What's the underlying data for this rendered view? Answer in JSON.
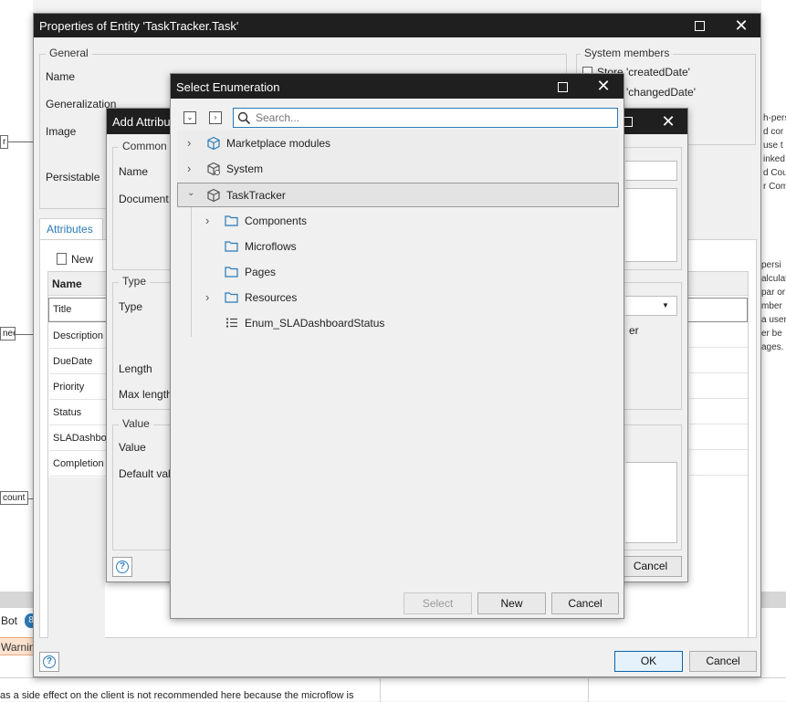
{
  "main_window": {
    "title": "Properties of Entity 'TaskTracker.Task'",
    "general_group": "General",
    "labels": {
      "name": "Name",
      "generalization": "Generalization",
      "image": "Image",
      "persistable": "Persistable"
    },
    "system_members_group": "System members",
    "system_members": [
      "Store 'createdDate'",
      "Store 'changedDate'"
    ],
    "tabs": [
      "Attributes"
    ],
    "new_button": "New",
    "attributes_table": {
      "header": "Name",
      "rows": [
        "Title",
        "Description",
        "DueDate",
        "Priority",
        "Status",
        "SLADashboa",
        "Completion"
      ]
    },
    "ok_button": "OK",
    "cancel_button": "Cancel"
  },
  "add_attribute_dialog": {
    "title": "Add Attribu",
    "common_group": "Common",
    "name_label": "Name",
    "documentation_label": "Document",
    "type_group": "Type",
    "type_label": "Type",
    "length_label": "Length",
    "max_length_label": "Max length",
    "value_group": "Value",
    "value_label": "Value",
    "default_value_label": "Default val",
    "partial_text": "er",
    "cancel_button": "Cancel"
  },
  "select_enumeration_dialog": {
    "title": "Select Enumeration",
    "search_placeholder": "Search...",
    "tree": {
      "marketplace": "Marketplace modules",
      "system": "System",
      "tasktracker": "TaskTracker",
      "components": "Components",
      "microflows": "Microflows",
      "pages": "Pages",
      "resources": "Resources",
      "enum_item": "Enum_SLADashboardStatus"
    },
    "select_button": "Select",
    "new_button": "New",
    "cancel_button": "Cancel"
  },
  "background": {
    "right_text": [
      "h-pers",
      "d cor",
      "use t",
      "inked",
      "d Cou",
      "r Com",
      "persi",
      "alculat",
      "par or",
      "mber",
      "a user",
      "er be",
      "ages."
    ],
    "left_nodes": [
      "r",
      "nee",
      "count"
    ],
    "bot_label": "Bot",
    "bot_badge": "8",
    "warning_label": "Warnin",
    "bottom_text": "as a side effect on the client is not recommended here because the microflow is"
  },
  "colors": {
    "titlebar": "#1f1f1f",
    "accent": "#2a7ab8",
    "folder": "#2a7ab8",
    "selection": "#e8e8e8"
  }
}
